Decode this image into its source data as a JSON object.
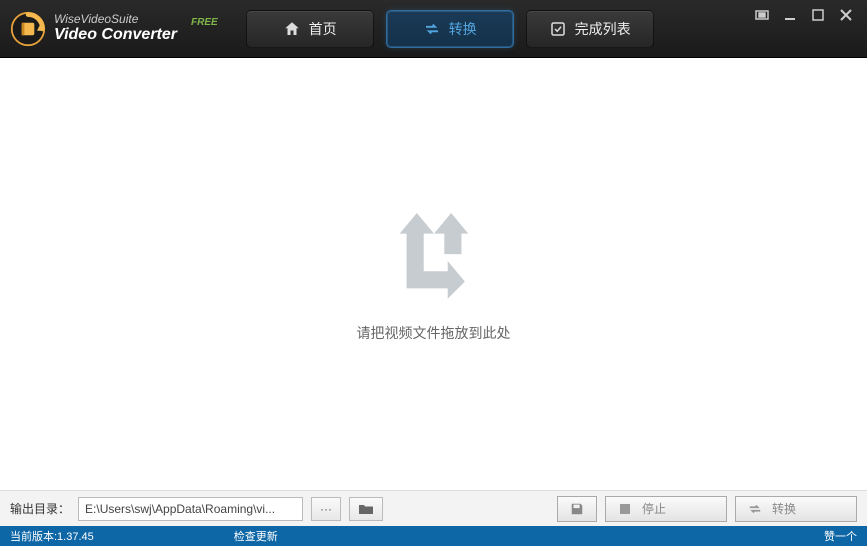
{
  "header": {
    "brand_line1": "WiseVideoSuite",
    "brand_line2": "Video Converter",
    "free_badge": "FREE",
    "tabs": {
      "home": "首页",
      "convert": "转换",
      "completed": "完成列表"
    }
  },
  "content": {
    "drop_hint": "请把视频文件拖放到此处"
  },
  "bottom": {
    "output_label": "输出目录：",
    "output_path": "E:\\Users\\swj\\AppData\\Roaming\\vi...",
    "browse_btn": "···",
    "stop_btn": "停止",
    "convert_btn": "转换"
  },
  "status": {
    "version": "当前版本:1.37.45",
    "check_update": "检查更新",
    "like": "赞一个"
  }
}
